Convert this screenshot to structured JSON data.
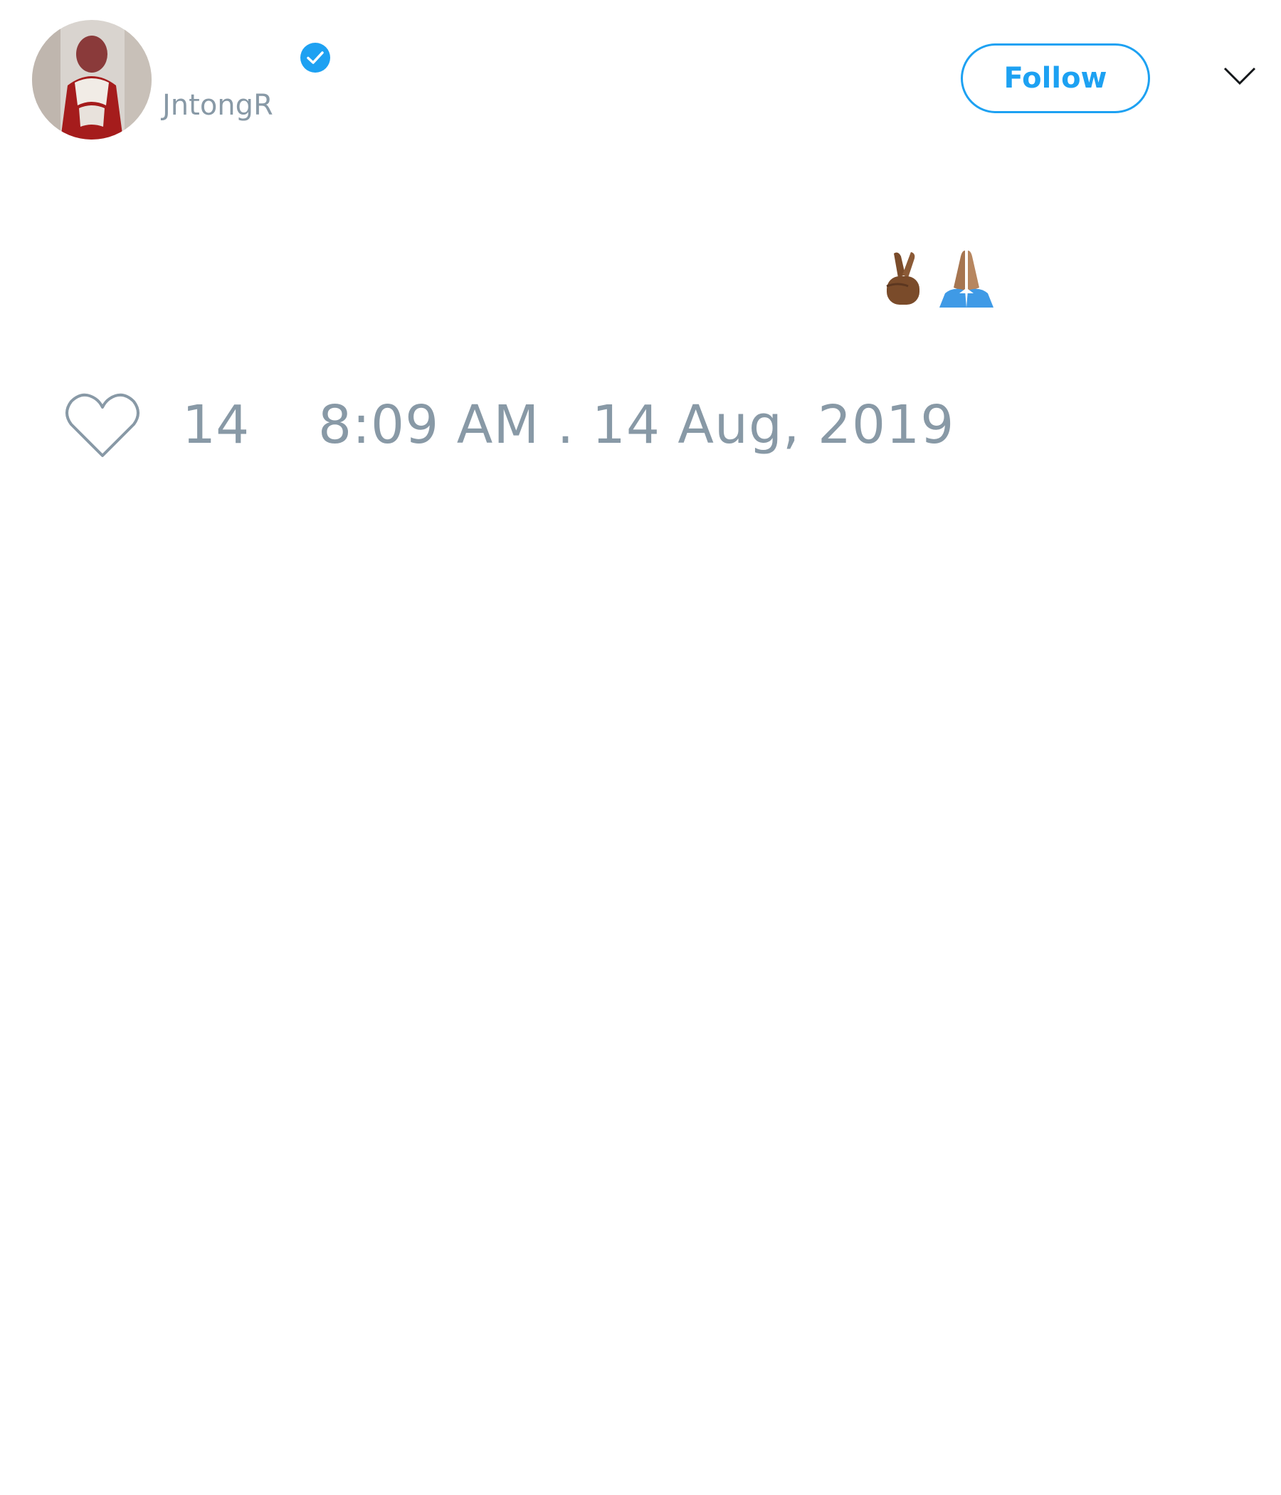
{
  "user": {
    "handle": "JntongR",
    "verified": true,
    "avatar": "profile-photo"
  },
  "header": {
    "follow_label": "Follow",
    "menu_icon": "chevron-down-icon"
  },
  "tweet": {
    "emojis": [
      "crossed-fingers-medium-dark-skin",
      "folded-hands-medium-skin"
    ]
  },
  "footer": {
    "like_icon": "heart-icon",
    "like_count": "14",
    "timestamp": "8:09 AM . 14 Aug, 2019"
  },
  "colors": {
    "accent": "#1da1f2",
    "muted": "#8899a6"
  }
}
